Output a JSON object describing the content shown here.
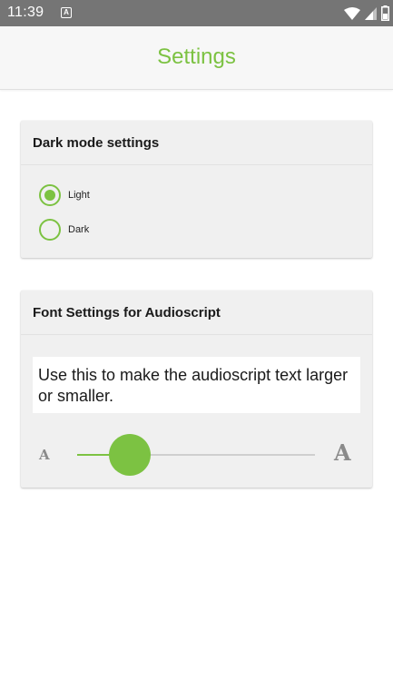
{
  "status_bar": {
    "time": "11:39",
    "notification_icon": "a-box-icon",
    "icons": [
      "wifi-icon",
      "signal-icon",
      "battery-icon"
    ]
  },
  "app_bar": {
    "title": "Settings"
  },
  "dark_mode_card": {
    "title": "Dark mode settings",
    "options": [
      {
        "label": "Light",
        "selected": true
      },
      {
        "label": "Dark",
        "selected": false
      }
    ]
  },
  "font_card": {
    "title": "Font Settings for Audioscript",
    "description": "Use this to make the audioscript text larger or smaller.",
    "slider": {
      "small_label": "A",
      "large_label": "A",
      "value_fraction": 0.22
    }
  },
  "colors": {
    "accent": "#7cc242",
    "status_bar": "#757575",
    "app_bar": "#f7f7f7",
    "card": "#f0f0f0"
  }
}
